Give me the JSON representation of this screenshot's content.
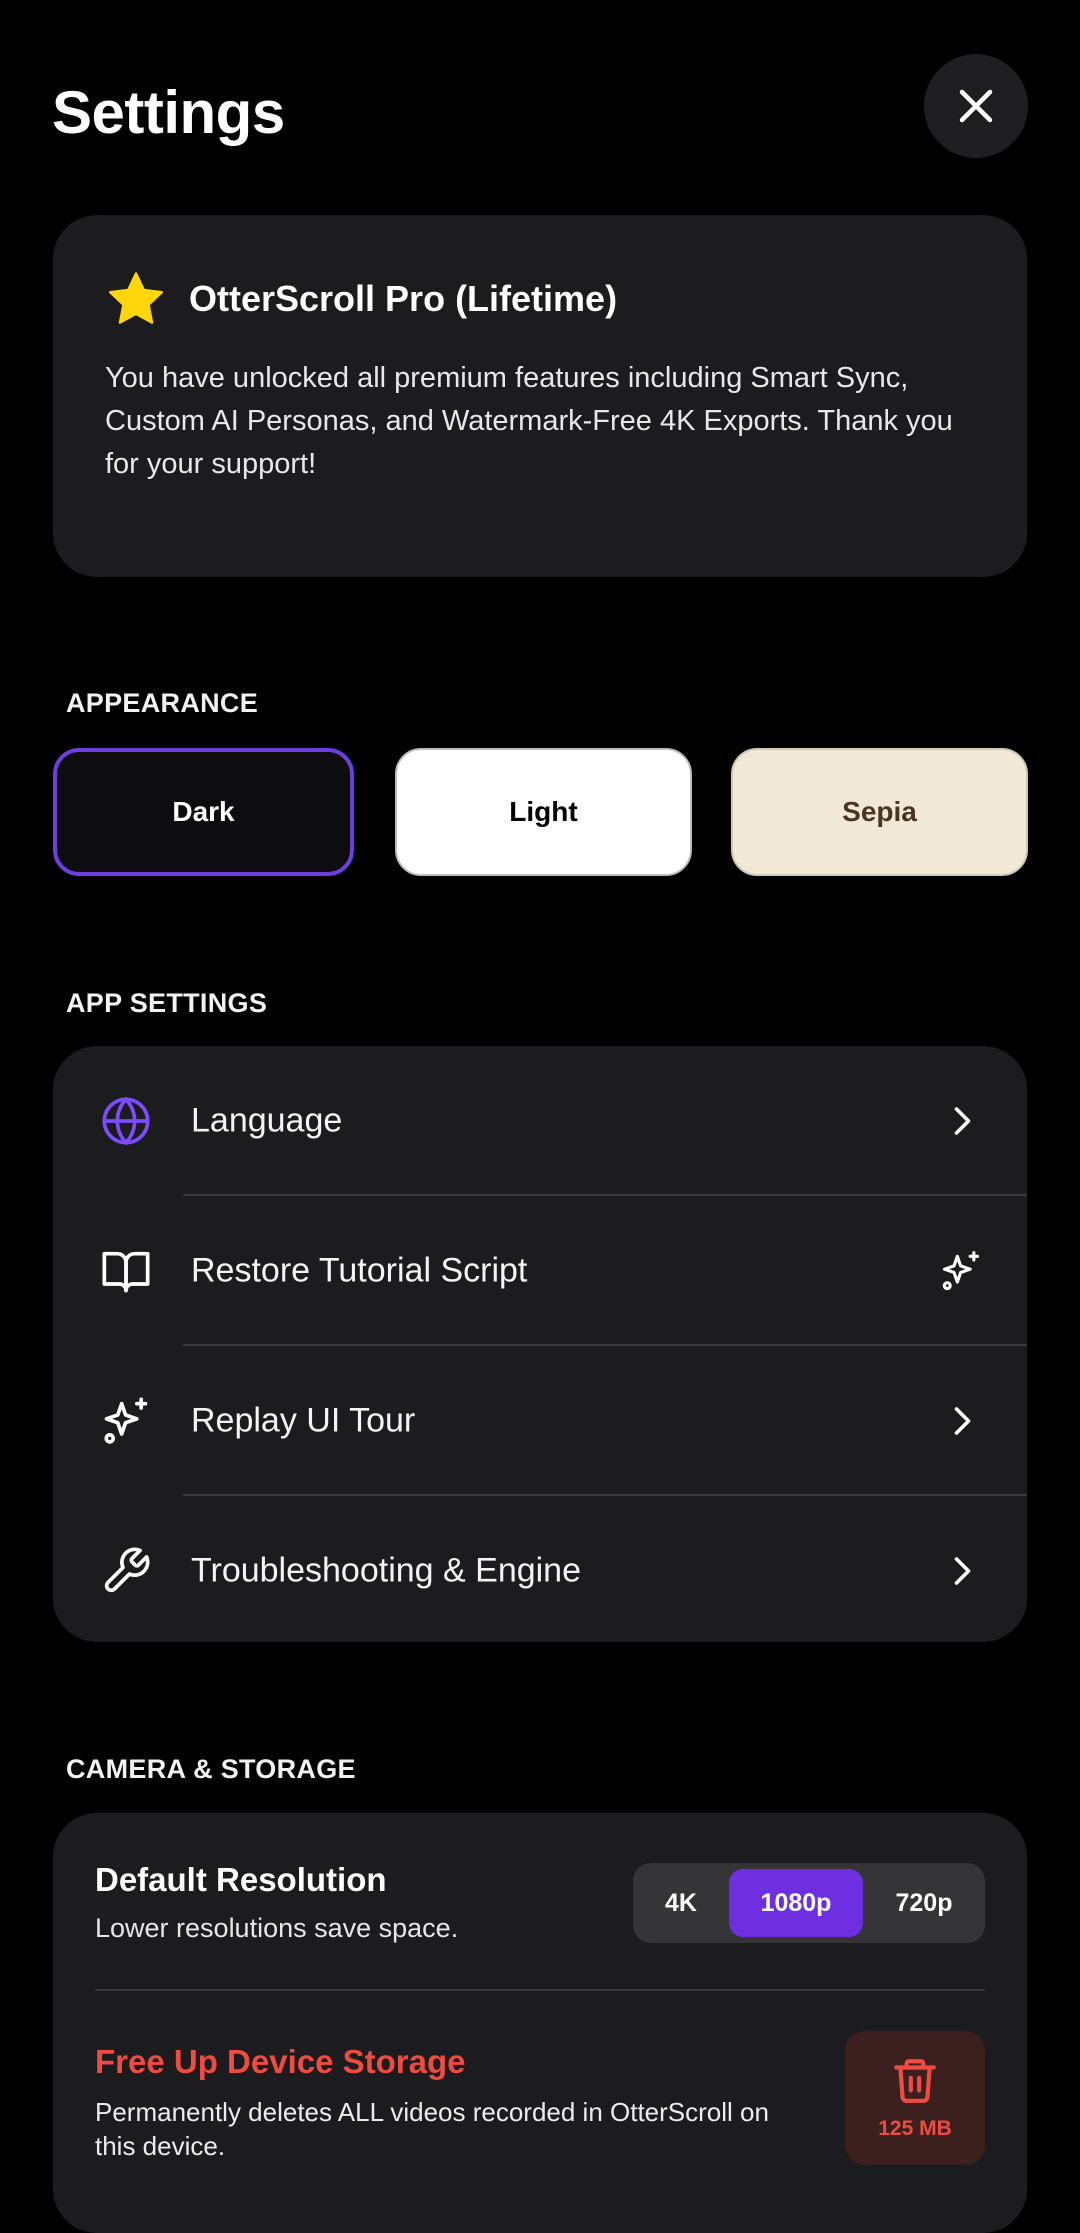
{
  "header": {
    "title": "Settings"
  },
  "pro": {
    "title": "OtterScroll Pro (Lifetime)",
    "description": "You have unlocked all premium features including Smart Sync, Custom AI Personas, and Watermark-Free 4K Exports. Thank you for your support!"
  },
  "appearance": {
    "section_label": "APPEARANCE",
    "options": [
      {
        "label": "Dark",
        "selected": true
      },
      {
        "label": "Light",
        "selected": false
      },
      {
        "label": "Sepia",
        "selected": false
      }
    ]
  },
  "app_settings": {
    "section_label": "APP SETTINGS",
    "items": [
      {
        "label": "Language",
        "icon": "globe-icon",
        "trailing": "chevron-right-icon"
      },
      {
        "label": "Restore Tutorial Script",
        "icon": "book-icon",
        "trailing": "sparkles-icon"
      },
      {
        "label": "Replay UI Tour",
        "icon": "sparkles-icon",
        "trailing": "chevron-right-icon"
      },
      {
        "label": "Troubleshooting & Engine",
        "icon": "wrench-icon",
        "trailing": "chevron-right-icon"
      }
    ]
  },
  "camera": {
    "section_label": "CAMERA & STORAGE",
    "resolution_title": "Default Resolution",
    "resolution_subtitle": "Lower resolutions save space.",
    "resolution_options": [
      "4K",
      "1080p",
      "720p"
    ],
    "selected_resolution": "1080p",
    "free_title": "Free Up Device Storage",
    "free_description": "Permanently deletes ALL videos recorded in OtterScroll on this device.",
    "storage_size": "125 MB"
  },
  "colors": {
    "accent": "#6D2FE0",
    "danger": "#EE4B41",
    "star": "#FFD60A",
    "card": "#1C1C1E"
  }
}
